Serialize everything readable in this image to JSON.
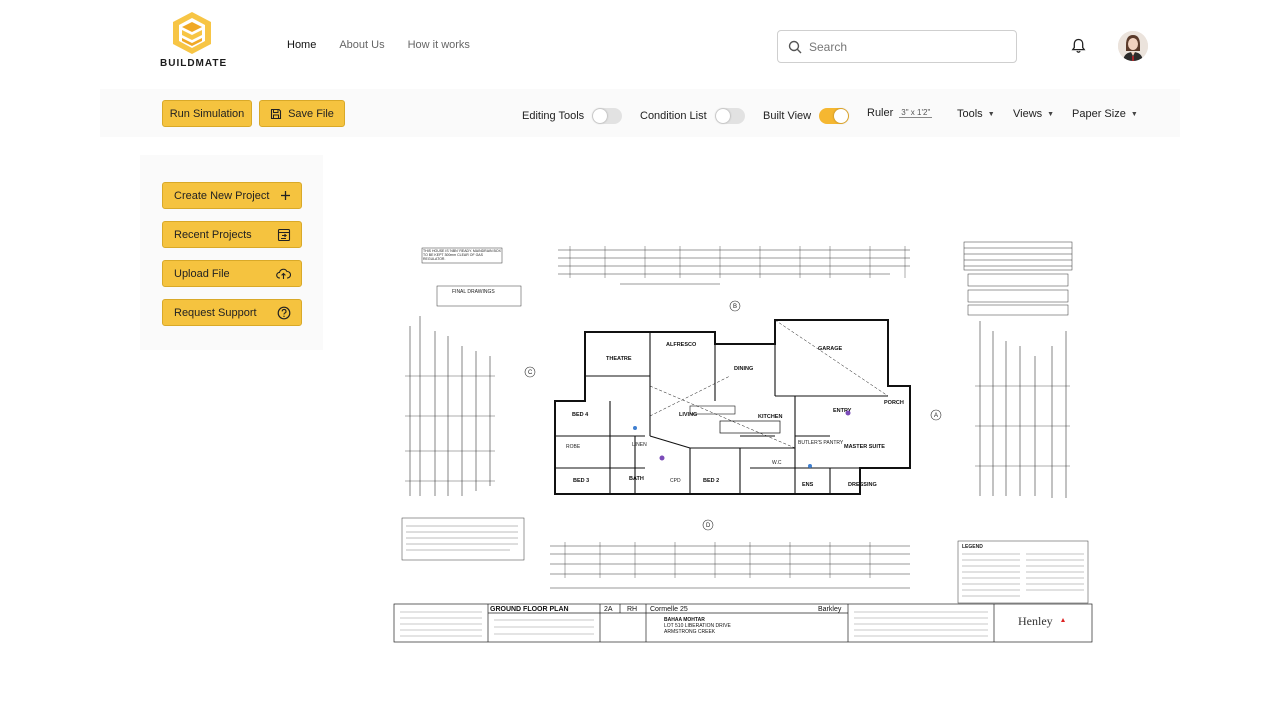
{
  "brand": {
    "name": "BUILDMATE",
    "accent": "#f5c33f"
  },
  "nav": {
    "home": "Home",
    "about": "About Us",
    "how": "How it works"
  },
  "search": {
    "placeholder": "Search",
    "icon": "search-icon"
  },
  "toolbar": {
    "run_simulation": "Run Simulation",
    "save_file": "Save File",
    "editing_tools": {
      "label": "Editing Tools",
      "on": false
    },
    "condition_list": {
      "label": "Condition List",
      "on": false
    },
    "built_view": {
      "label": "Built View",
      "on": true
    },
    "ruler": {
      "label": "Ruler",
      "value": "3\" x 1'2\""
    },
    "tools": "Tools",
    "views": "Views",
    "paper_size": "Paper Size"
  },
  "sidebar": {
    "create_project": "Create New Project",
    "recent_projects": "Recent Projects",
    "upload_file": "Upload File",
    "request_support": "Request Support"
  },
  "drawing": {
    "title": "GROUND FLOOR PLAN",
    "rev": "2A",
    "hand": "RH",
    "design": "Cormelle 25",
    "facade": "Barkley",
    "client": "BAHAA MOHTAR",
    "address_1": "LOT 510 LIBERATION DRIVE",
    "address_2": "ARMSTRONG CREEK",
    "brand": "Henley",
    "final_drawings": "FINAL DRAWINGS",
    "legend": "LEGEND",
    "nbn_note": "THIS HOUSE IS 'NBN' READY. MAINDRAIN BOX TO BE KEPT 300mm CLEAR OF GAS REGULATOR.",
    "rooms": {
      "theatre": "THEATRE",
      "alfresco": "ALFRESCO",
      "dining": "DINING",
      "garage": "GARAGE",
      "bed4": "BED 4",
      "living": "LIVING",
      "kitchen": "KITCHEN",
      "entry": "ENTRY",
      "porch": "PORCH",
      "bed3": "BED 3",
      "bath": "BATH",
      "bed2": "BED 2",
      "master": "MASTER SUITE",
      "ens": "ENS",
      "dressing": "DRESSING",
      "pantry": "BUTLER'S PANTRY",
      "wc": "W.C",
      "linen": "LINEN",
      "robe": "ROBE",
      "cpd": "CPD"
    },
    "markers": {
      "a": "A",
      "b": "B",
      "c": "C",
      "d": "D"
    }
  }
}
